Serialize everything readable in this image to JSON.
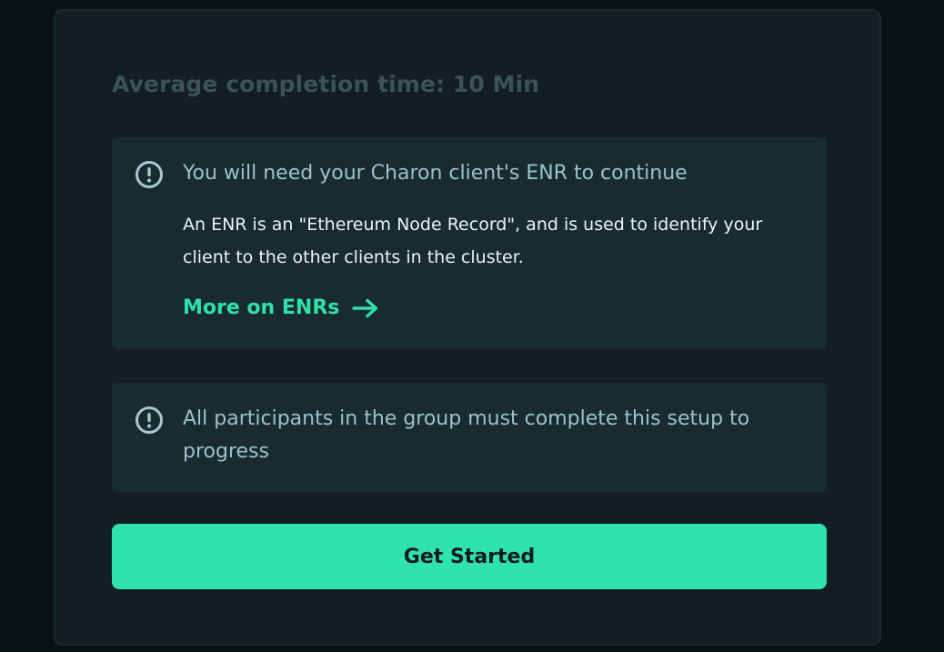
{
  "card": {
    "average_time_text": "Average completion time: 10 Min"
  },
  "enr_notice": {
    "icon": "alert-circle-icon",
    "title": "You will need your Charon client's ENR to continue",
    "body": "An ENR is an \"Ethereum Node Record\", and is used to identify your client to the other clients in the cluster.",
    "link_label": "More on ENRs",
    "link_icon": "arrow-right-icon"
  },
  "participants_notice": {
    "icon": "alert-circle-icon",
    "title": "All participants in the group must complete this setup to progress"
  },
  "cta": {
    "label": "Get Started"
  },
  "colors": {
    "page_background": "#0a1214",
    "card_background": "#121e22",
    "notice_background": "#182b30",
    "accent": "#2fe3ab",
    "muted_text": "#3b5358",
    "notice_title_text": "#9cc3c5"
  }
}
